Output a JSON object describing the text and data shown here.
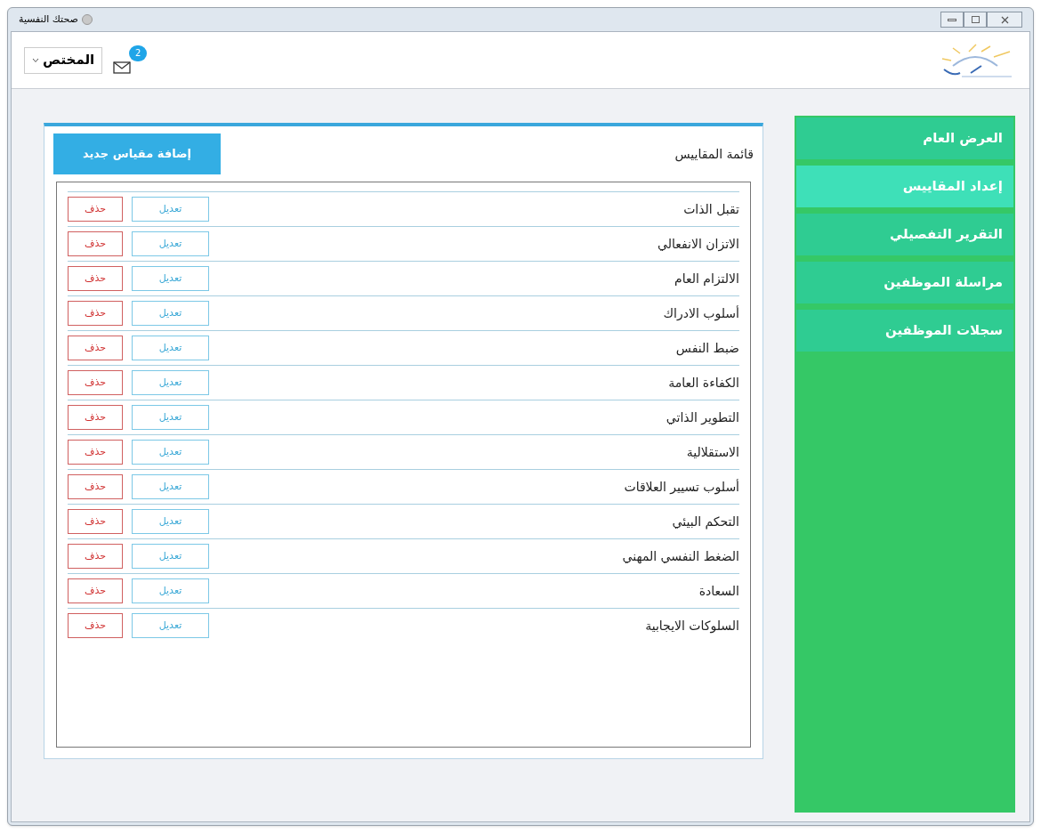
{
  "window": {
    "title": "صحتك النفسية"
  },
  "toolbar": {
    "user_menu": "المختص",
    "messages_badge": "2"
  },
  "sidebar": {
    "items": [
      {
        "label": "العرض العام",
        "selected": false
      },
      {
        "label": "إعداد المقاييس",
        "selected": true
      },
      {
        "label": "التقرير التفصيلي",
        "selected": false
      },
      {
        "label": "مراسلة الموظفين",
        "selected": false
      },
      {
        "label": "سجلات الموظفين",
        "selected": false
      }
    ]
  },
  "panel": {
    "title": "قائمة المقاييس",
    "add_button": "إضافة مقياس جديد",
    "rows": [
      {
        "name": "تقبل الذات",
        "edit": "تعديل",
        "delete": "حذف"
      },
      {
        "name": "الاتزان الانفعالي",
        "edit": "تعديل",
        "delete": "حذف"
      },
      {
        "name": "الالتزام العام",
        "edit": "تعديل",
        "delete": "حذف"
      },
      {
        "name": "أسلوب الادراك",
        "edit": "تعديل",
        "delete": "حذف"
      },
      {
        "name": "ضبط النفس",
        "edit": "تعديل",
        "delete": "حذف"
      },
      {
        "name": "الكفاءة العامة",
        "edit": "تعديل",
        "delete": "حذف"
      },
      {
        "name": "التطوير الذاتي",
        "edit": "تعديل",
        "delete": "حذف"
      },
      {
        "name": "الاستقلالية",
        "edit": "تعديل",
        "delete": "حذف"
      },
      {
        "name": "أسلوب تسيير العلاقات",
        "edit": "تعديل",
        "delete": "حذف"
      },
      {
        "name": "التحكم البيئي",
        "edit": "تعديل",
        "delete": "حذف"
      },
      {
        "name": "الضغط النفسي المهني",
        "edit": "تعديل",
        "delete": "حذف"
      },
      {
        "name": "السعادة",
        "edit": "تعديل",
        "delete": "حذف"
      },
      {
        "name": "السلوكات الايجابية",
        "edit": "تعديل",
        "delete": "حذف"
      }
    ]
  }
}
